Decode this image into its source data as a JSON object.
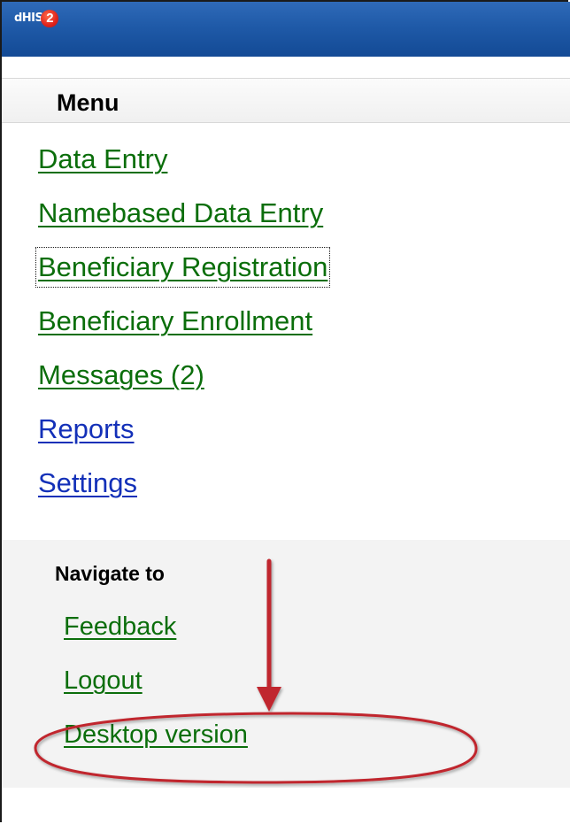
{
  "header": {
    "logo_text": "dHIS",
    "logo_badge": "2"
  },
  "menu": {
    "title": "Menu",
    "items": [
      {
        "label": "Data Entry",
        "color": "#0b6e0b"
      },
      {
        "label": "Namebased Data Entry",
        "color": "#0b6e0b"
      },
      {
        "label": "Beneficiary Registration",
        "color": "#0b6e0b"
      },
      {
        "label": "Beneficiary Enrollment",
        "color": "#0b6e0b"
      },
      {
        "label": "Messages (2)",
        "color": "#0b6e0b"
      },
      {
        "label": "Reports",
        "color": "#1330b8"
      },
      {
        "label": "Settings",
        "color": "#1330b8"
      }
    ]
  },
  "navigate": {
    "title": "Navigate to",
    "items": [
      {
        "label": "Feedback"
      },
      {
        "label": "Logout"
      },
      {
        "label": "Desktop version"
      }
    ]
  },
  "annotation": {
    "color": "#c0272d",
    "icons": [
      "arrow-down-icon",
      "highlight-ellipse"
    ]
  }
}
